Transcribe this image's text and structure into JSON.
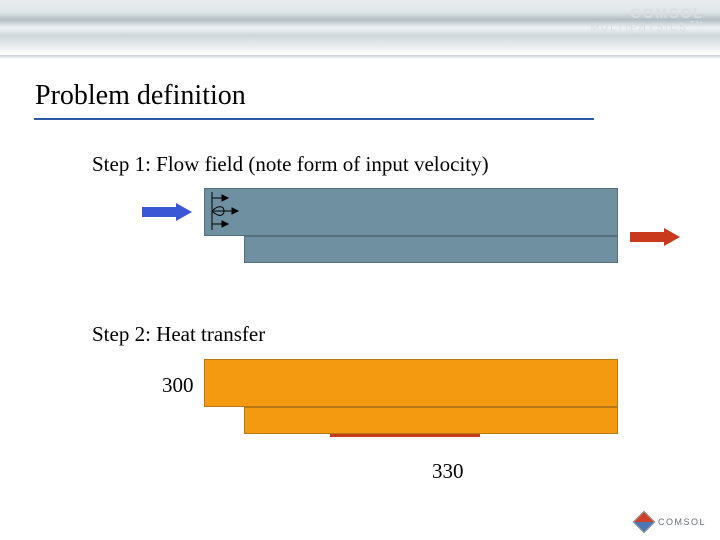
{
  "brand": {
    "line1": "COMSOL",
    "line2": "MULTIPHYSICS",
    "tm": "TM",
    "footer": "COMSOL"
  },
  "title": "Problem definition",
  "step1_text": "Step 1: Flow field (note form of input velocity)",
  "step2_text": "Step 2: Heat transfer",
  "temperatures": {
    "inlet": "300",
    "wall": "330"
  },
  "colors": {
    "flow_fill": "#6f90a1",
    "heat_fill": "#f49a11",
    "inlet_arrow": "#3a58d6",
    "outlet_arrow": "#c9391b",
    "title_underline": "#2a5aa4",
    "hot_wall_line": "#c9391b"
  }
}
